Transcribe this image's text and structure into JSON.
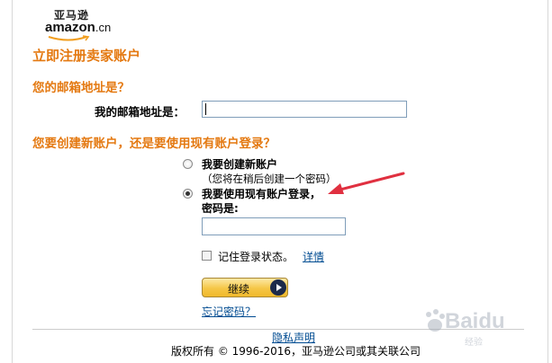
{
  "logo": {
    "top_text": "亚马逊",
    "brand": "amazon",
    "brand_suffix": ".cn"
  },
  "page_title": "立即注册卖家账户",
  "email_section": {
    "heading": "您的邮箱地址是？",
    "label": "我的邮箱地址是：",
    "value": ""
  },
  "account_section": {
    "heading": "您要创建新账户，还是要使用现有账户登录？",
    "option_new": {
      "label": "我要创建新账户",
      "sub": "（您将在稍后创建一个密码）",
      "selected": false
    },
    "option_existing": {
      "label": "我要使用现有账户登录，",
      "selected": true
    },
    "password_label": "密码是:",
    "password_value": ""
  },
  "remember": {
    "label": "记住登录状态。",
    "details_link": "详情",
    "checked": false
  },
  "continue_button": "继续",
  "forgot_password": "忘记密码？",
  "footer": {
    "privacy": "隐私声明",
    "copyright": "版权所有 © 1996-2016，亚马逊公司或其关联公司"
  },
  "watermark": {
    "text": "Baidu",
    "sub": "经验"
  },
  "colors": {
    "accent": "#e47911",
    "link": "#004b91",
    "arrow": "#e03040"
  }
}
